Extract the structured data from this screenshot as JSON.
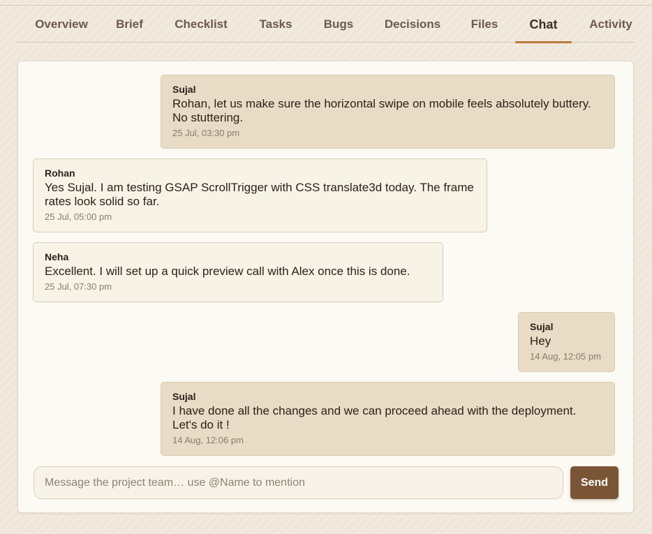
{
  "tabs": [
    {
      "label": "Overview"
    },
    {
      "label": "Brief"
    },
    {
      "label": "Checklist"
    },
    {
      "label": "Tasks"
    },
    {
      "label": "Bugs"
    },
    {
      "label": "Decisions"
    },
    {
      "label": "Files"
    },
    {
      "label": "Chat",
      "active": true
    },
    {
      "label": "Activity"
    }
  ],
  "chat": {
    "messages": [
      {
        "author": "Sujal",
        "text": "Rohan, let us make sure the horizontal swipe on mobile feels absolutely buttery. No stuttering.",
        "time": "25 Jul, 03:30 pm",
        "mine": true
      },
      {
        "author": "Rohan",
        "text": "Yes Sujal. I am testing GSAP ScrollTrigger with CSS translate3d today. The frame rates look solid so far.",
        "time": "25 Jul, 05:00 pm",
        "mine": false
      },
      {
        "author": "Neha",
        "text": "Excellent. I will set up a quick preview call with Alex once this is done.",
        "time": "25 Jul, 07:30 pm",
        "mine": false
      },
      {
        "author": "Sujal",
        "text": "Hey",
        "time": "14 Aug, 12:05 pm",
        "mine": true
      },
      {
        "author": "Sujal",
        "text": "I have done all the changes and we can proceed ahead with the deployment. Let's do it !",
        "time": "14 Aug, 12:06 pm",
        "mine": true
      }
    ]
  },
  "composer": {
    "value": "",
    "placeholder": "Message the project team… use @Name to mention",
    "send_label": "Send"
  },
  "colors": {
    "accent": "#b97a3e",
    "send_button": "#7a5535",
    "my_bubble": "#e8dcc6",
    "their_bubble": "#f8f3e7"
  }
}
